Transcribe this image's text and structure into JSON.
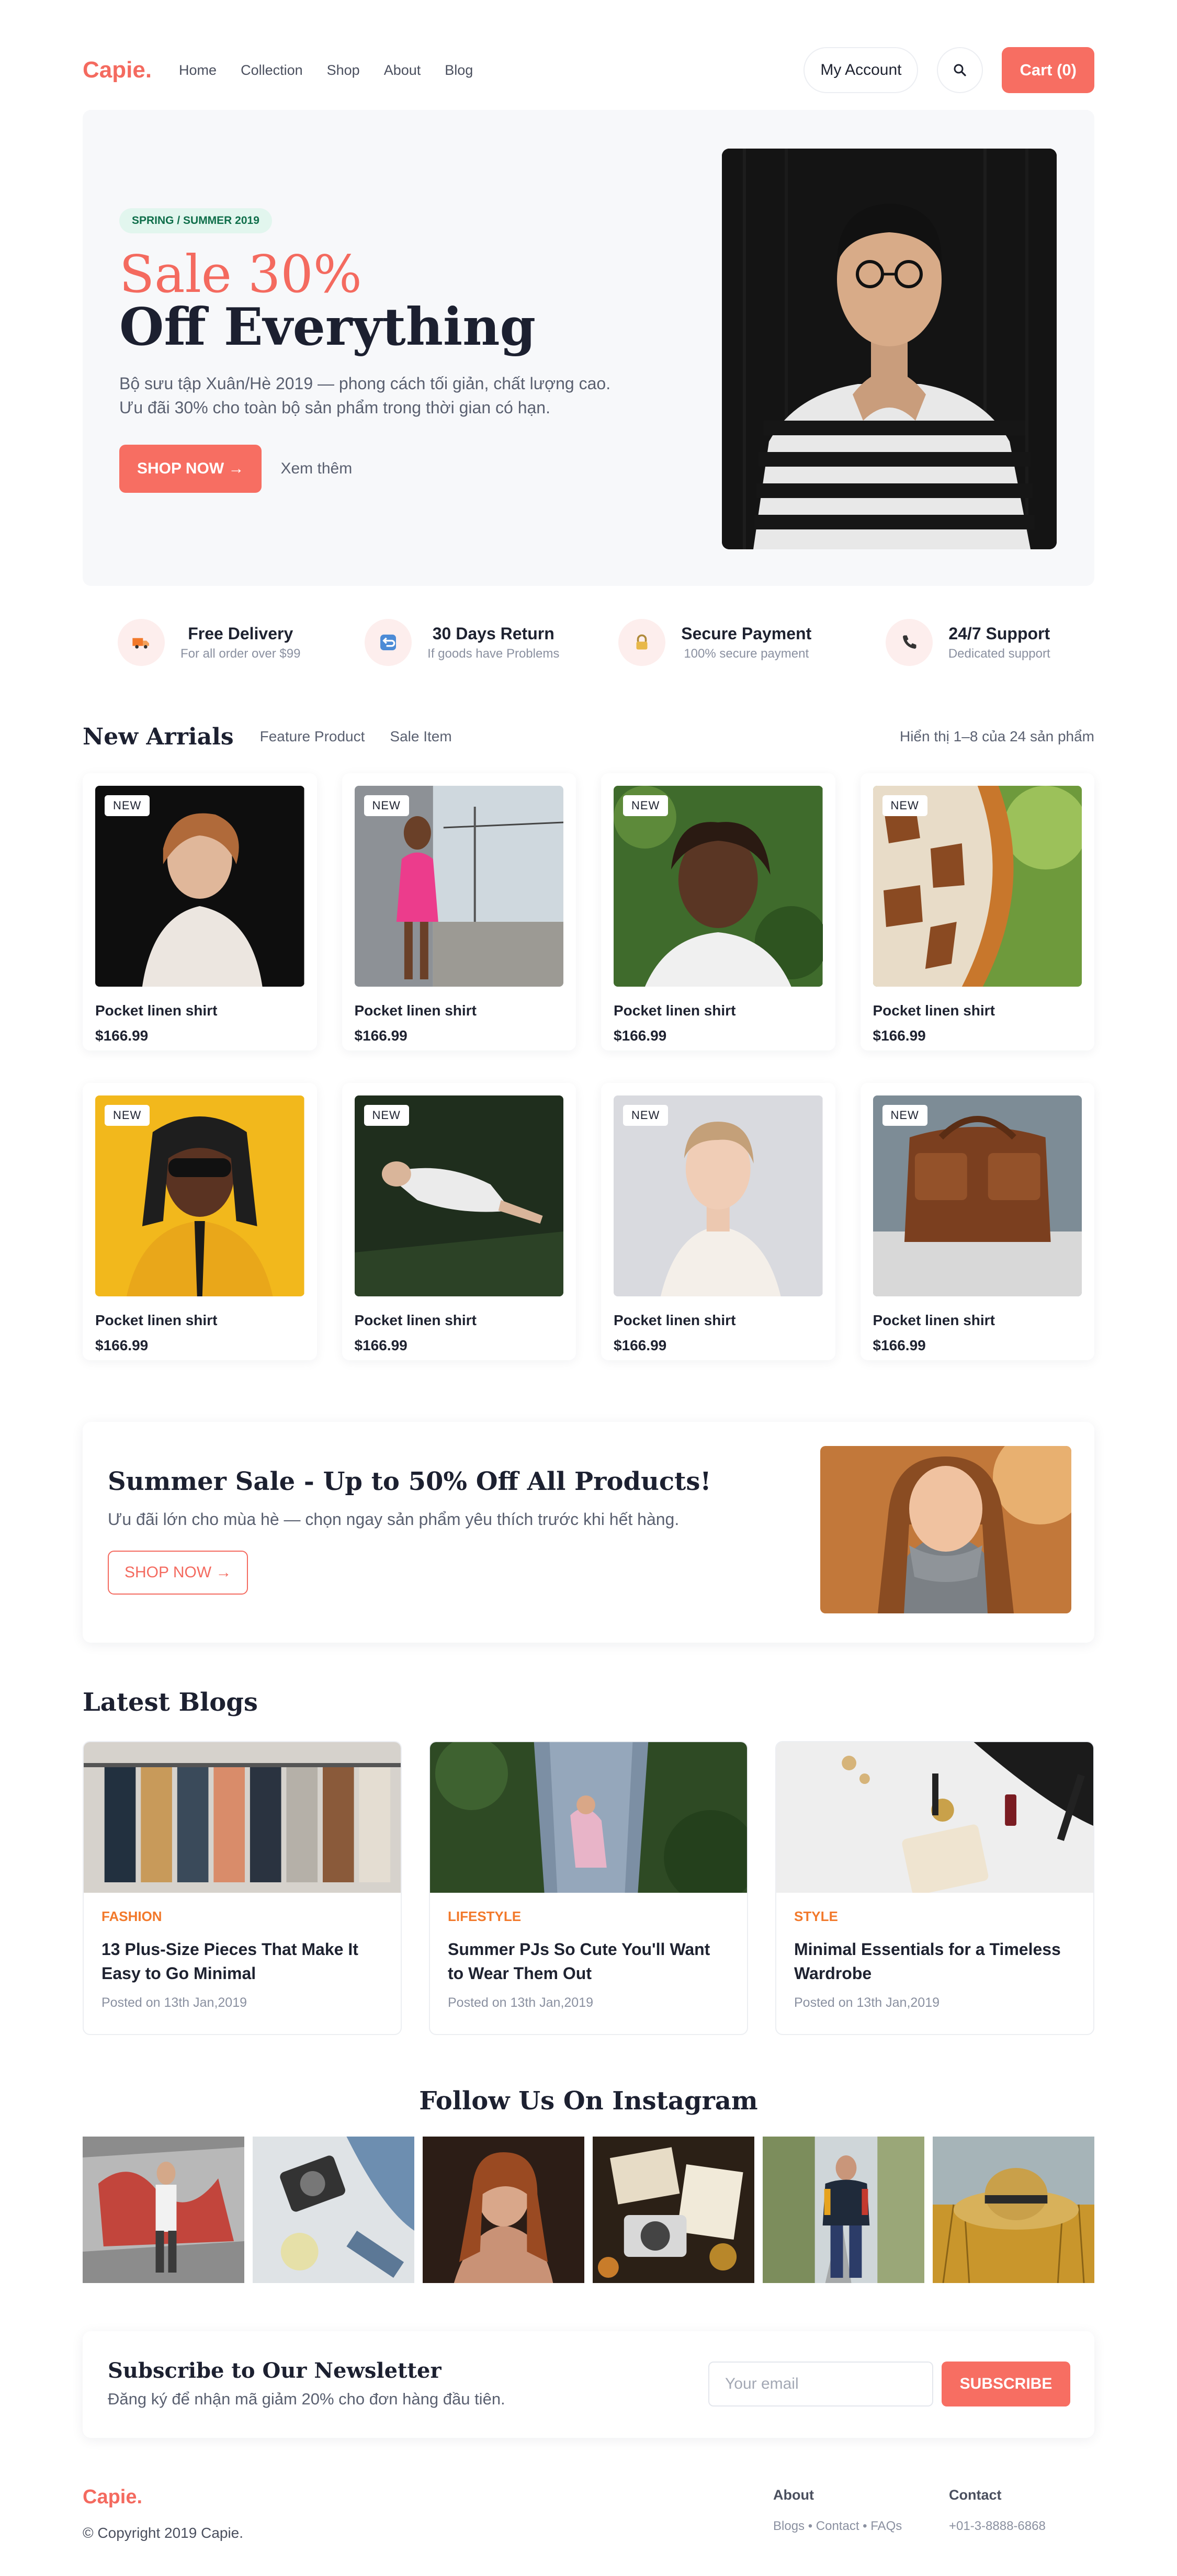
{
  "header": {
    "logo": "Capie.",
    "nav": [
      "Home",
      "Collection",
      "Shop",
      "About",
      "Blog"
    ],
    "account_label": "My Account",
    "search_icon": "search-icon",
    "cart_label": "Cart (0)"
  },
  "hero": {
    "badge": "SPRING / SUMMER 2019",
    "title_line1": "Sale 30%",
    "title_line2": "Off Everything",
    "desc_line1": "Bộ sưu tập Xuân/Hè 2019 — phong cách tối giản, chất lượng cao.",
    "desc_line2": "Ưu đãi 30% cho toàn bộ sản phẩm trong thời gian có hạn.",
    "cta_label": "SHOP NOW →",
    "secondary_label": "Xem thêm"
  },
  "features": [
    {
      "icon": "truck-icon",
      "title": "Free Delivery",
      "subtitle": "For all order over $99"
    },
    {
      "icon": "return-icon",
      "title": "30 Days Return",
      "subtitle": "If goods have Problems"
    },
    {
      "icon": "lock-icon",
      "title": "Secure Payment",
      "subtitle": "100% secure payment"
    },
    {
      "icon": "phone-icon",
      "title": "24/7 Support",
      "subtitle": "Dedicated support"
    }
  ],
  "products_section": {
    "title": "New Arrials",
    "tabs": [
      "Feature Product",
      "Sale Item"
    ],
    "count_text": "Hiển thị 1–8 của 24 sản phẩm"
  },
  "products": [
    {
      "badge": "NEW",
      "name": "Pocket linen shirt",
      "price": "$166.99"
    },
    {
      "badge": "NEW",
      "name": "Pocket linen shirt",
      "price": "$166.99"
    },
    {
      "badge": "NEW",
      "name": "Pocket linen shirt",
      "price": "$166.99"
    },
    {
      "badge": "NEW",
      "name": "Pocket linen shirt",
      "price": "$166.99"
    },
    {
      "badge": "NEW",
      "name": "Pocket linen shirt",
      "price": "$166.99"
    },
    {
      "badge": "NEW",
      "name": "Pocket linen shirt",
      "price": "$166.99"
    },
    {
      "badge": "NEW",
      "name": "Pocket linen shirt",
      "price": "$166.99"
    },
    {
      "badge": "NEW",
      "name": "Pocket linen shirt",
      "price": "$166.99"
    }
  ],
  "promo": {
    "title": "Summer Sale - Up to 50% Off All Products!",
    "desc": "Ưu đãi lớn cho mùa hè — chọn ngay sản phẩm yêu thích trước khi hết hàng.",
    "cta_label": "SHOP NOW →"
  },
  "blogs": {
    "title": "Latest Blogs",
    "items": [
      {
        "category": "FASHION",
        "title": "13 Plus-Size Pieces That Make It Easy to Go Minimal",
        "date": "Posted on 13th Jan,2019"
      },
      {
        "category": "LIFESTYLE",
        "title": "Summer PJs So Cute You'll Want to Wear Them Out",
        "date": "Posted on 13th Jan,2019"
      },
      {
        "category": "STYLE",
        "title": "Minimal Essentials for a Timeless Wardrobe",
        "date": "Posted on 13th Jan,2019"
      }
    ]
  },
  "instagram": {
    "title": "Follow Us On Instagram"
  },
  "newsletter": {
    "title": "Subscribe to Our Newsletter",
    "desc": "Đăng ký để nhận mã giảm 20% cho đơn hàng đầu tiên.",
    "placeholder": "Your email",
    "button_label": "SUBSCRIBE"
  },
  "footer": {
    "logo": "Capie.",
    "copyright": "© Copyright 2019 Capie.",
    "about_heading": "About",
    "about_links": "Blogs • Contact • FAQs",
    "contact_heading": "Contact",
    "contact_phone": "+01-3-8888-6868"
  },
  "colors": {
    "accent": "#f76e62",
    "badge_bg": "#e2f6ee",
    "blog_category": "#f2792b"
  }
}
